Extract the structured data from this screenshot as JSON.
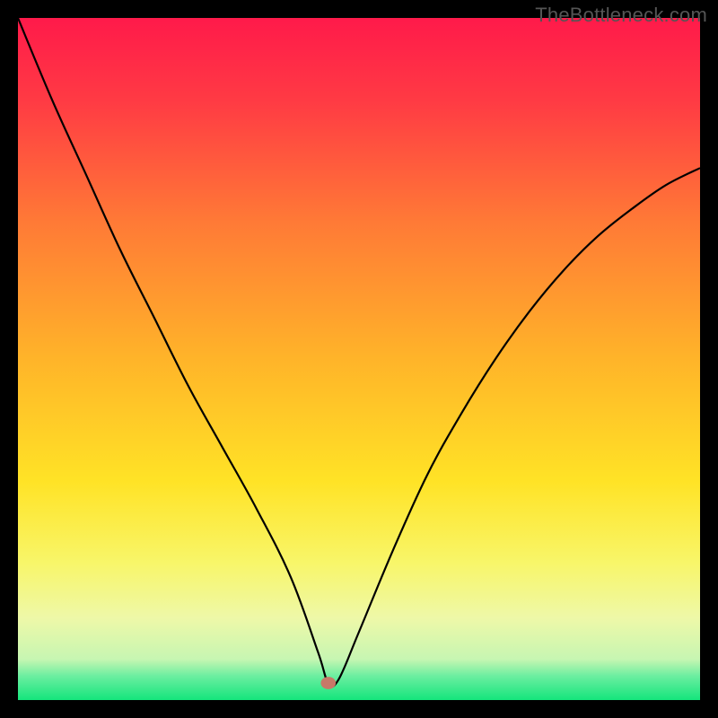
{
  "watermark": "TheBottleneck.com",
  "chart_data": {
    "type": "line",
    "title": "",
    "xlabel": "",
    "ylabel": "",
    "xlim": [
      0,
      100
    ],
    "ylim": [
      0,
      100
    ],
    "grid": false,
    "legend": false,
    "background_gradient": {
      "stops": [
        {
          "offset": 0.0,
          "color": "#ff1a4a"
        },
        {
          "offset": 0.12,
          "color": "#ff3a44"
        },
        {
          "offset": 0.3,
          "color": "#ff7a36"
        },
        {
          "offset": 0.5,
          "color": "#ffb429"
        },
        {
          "offset": 0.68,
          "color": "#ffe326"
        },
        {
          "offset": 0.8,
          "color": "#f8f66a"
        },
        {
          "offset": 0.88,
          "color": "#eef8a8"
        },
        {
          "offset": 0.94,
          "color": "#c7f6b2"
        },
        {
          "offset": 0.965,
          "color": "#6beea0"
        },
        {
          "offset": 1.0,
          "color": "#14e57c"
        }
      ]
    },
    "series": [
      {
        "name": "bottleneck-curve",
        "x": [
          0,
          5,
          10,
          15,
          20,
          25,
          30,
          35,
          40,
          44,
          45.5,
          47,
          50,
          55,
          60,
          65,
          70,
          75,
          80,
          85,
          90,
          95,
          100
        ],
        "y": [
          100,
          88,
          77,
          66,
          56,
          46,
          37,
          28,
          18,
          7,
          2.5,
          3,
          10,
          22,
          33,
          42,
          50,
          57,
          63,
          68,
          72,
          75.5,
          78
        ]
      }
    ],
    "marker": {
      "name": "optimal-point",
      "x": 45.5,
      "y": 2.5,
      "rx": 1.1,
      "ry": 0.9,
      "color": "#c87868"
    }
  }
}
